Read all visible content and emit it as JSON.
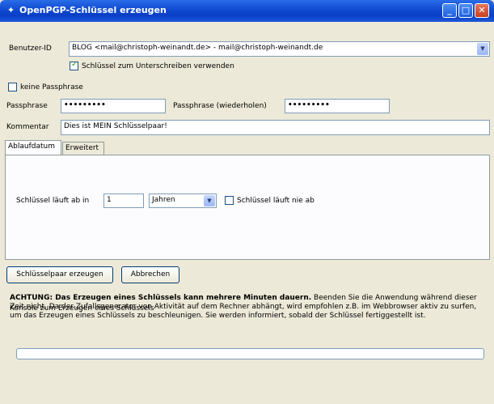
{
  "window": {
    "title": "OpenPGP-Schlüssel erzeugen",
    "controls": {
      "minimize": "_",
      "maximize": "□",
      "close": "✕"
    }
  },
  "form": {
    "user_id": {
      "label": "Benutzer-ID",
      "value": "BLOG <mail@christoph-weinandt.de> - mail@christoph-weinandt.de"
    },
    "use_for_signing": {
      "label": "Schlüssel zum Unterschreiben verwenden",
      "checked": true
    },
    "no_passphrase": {
      "label": "keine Passphrase",
      "checked": false
    },
    "passphrase": {
      "label": "Passphrase",
      "value": "•••••••••"
    },
    "passphrase_repeat": {
      "label": "Passphrase (wiederholen)",
      "value": "•••••••••"
    },
    "comment": {
      "label": "Kommentar",
      "value": "Dies ist MEIN Schlüsselpaar!"
    }
  },
  "tabs": [
    {
      "label": "Ablaufdatum",
      "active": true
    },
    {
      "label": "Erweitert",
      "active": false
    }
  ],
  "expiry": {
    "label": "Schlüssel läuft ab in",
    "amount": "1",
    "unit": "Jahren",
    "never_expires": {
      "label": "Schlüssel läuft nie ab",
      "checked": false
    }
  },
  "buttons": {
    "generate": "Schlüsselpaar erzeugen",
    "cancel": "Abbrechen"
  },
  "console": {
    "heading": "Konsole zum Erzeugen eines Schlüssels",
    "warning_bold": "ACHTUNG: Das Erzeugen eines Schlüssels kann mehrere Minuten dauern.",
    "warning_text": " Beenden Sie die Anwendung während dieser Zeit nicht. Da der Zufallsgenerator von Aktivität auf dem Rechner abhängt, wird empfohlen z.B. im Webbrowser aktiv zu surfen, um das Erzeugen eines Schlüssels zu beschleunigen. Sie werden informiert, sobald der Schlüssel fertiggestellt ist."
  },
  "progress": {
    "percent": 0
  },
  "colors": {
    "title_bar": "#0a3fc6",
    "dialog_bg": "#ece9d8",
    "field_border": "#7f9db9"
  }
}
